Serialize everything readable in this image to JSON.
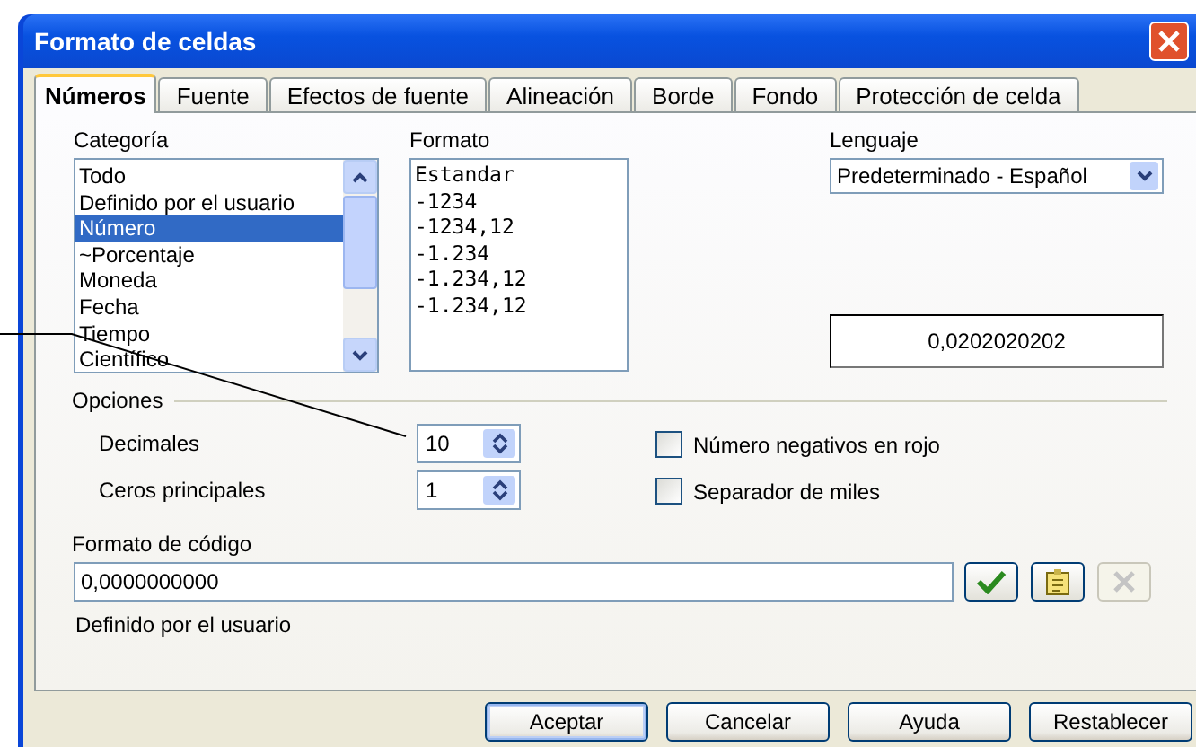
{
  "window": {
    "title": "Formato de celdas"
  },
  "tabs": [
    {
      "label": "Números",
      "selected": true
    },
    {
      "label": "Fuente",
      "selected": false
    },
    {
      "label": "Efectos de fuente",
      "selected": false
    },
    {
      "label": "Alineación",
      "selected": false
    },
    {
      "label": "Borde",
      "selected": false
    },
    {
      "label": "Fondo",
      "selected": false
    },
    {
      "label": "Protección de celda",
      "selected": false
    }
  ],
  "category": {
    "label": "Categoría",
    "items": [
      {
        "text": "Todo",
        "selected": false
      },
      {
        "text": "Definido por el usuario",
        "selected": false
      },
      {
        "text": "Número",
        "selected": true
      },
      {
        "text": "~Porcentaje",
        "selected": false
      },
      {
        "text": "Moneda",
        "selected": false
      },
      {
        "text": "Fecha",
        "selected": false
      },
      {
        "text": "Tiempo",
        "selected": false
      },
      {
        "text": "Científico",
        "selected": false
      }
    ]
  },
  "format": {
    "label": "Formato",
    "items": [
      {
        "text": "Estandar",
        "selected": false
      },
      {
        "text": "-1234",
        "selected": false
      },
      {
        "text": "-1234,12",
        "selected": false
      },
      {
        "text": "-1.234",
        "selected": false
      },
      {
        "text": "-1.234,12",
        "selected": false
      },
      {
        "text": "-1.234,12",
        "selected": false
      }
    ]
  },
  "language": {
    "label": "Lenguaje",
    "value": "Predeterminado - Español"
  },
  "preview": "0,0202020202",
  "options": {
    "title": "Opciones",
    "spinners": [
      {
        "label": "Decimales",
        "value": "10"
      },
      {
        "label": "Ceros principales",
        "value": "1"
      }
    ],
    "checkboxes": [
      {
        "label": "Número negativos en rojo",
        "checked": false
      },
      {
        "label": "Separador de miles",
        "checked": false
      }
    ]
  },
  "format_code": {
    "label": "Formato de código",
    "value": "0,0000000000",
    "buttons": [
      {
        "kind": "accept",
        "disabled": false
      },
      {
        "kind": "comment",
        "disabled": false
      },
      {
        "kind": "delete",
        "disabled": true
      }
    ],
    "description": "Definido por el usuario"
  },
  "buttons": [
    {
      "label": "Aceptar",
      "default": true
    },
    {
      "label": "Cancelar",
      "default": false
    },
    {
      "label": "Ayuda",
      "default": false
    },
    {
      "label": "Restablecer",
      "default": false
    }
  ]
}
